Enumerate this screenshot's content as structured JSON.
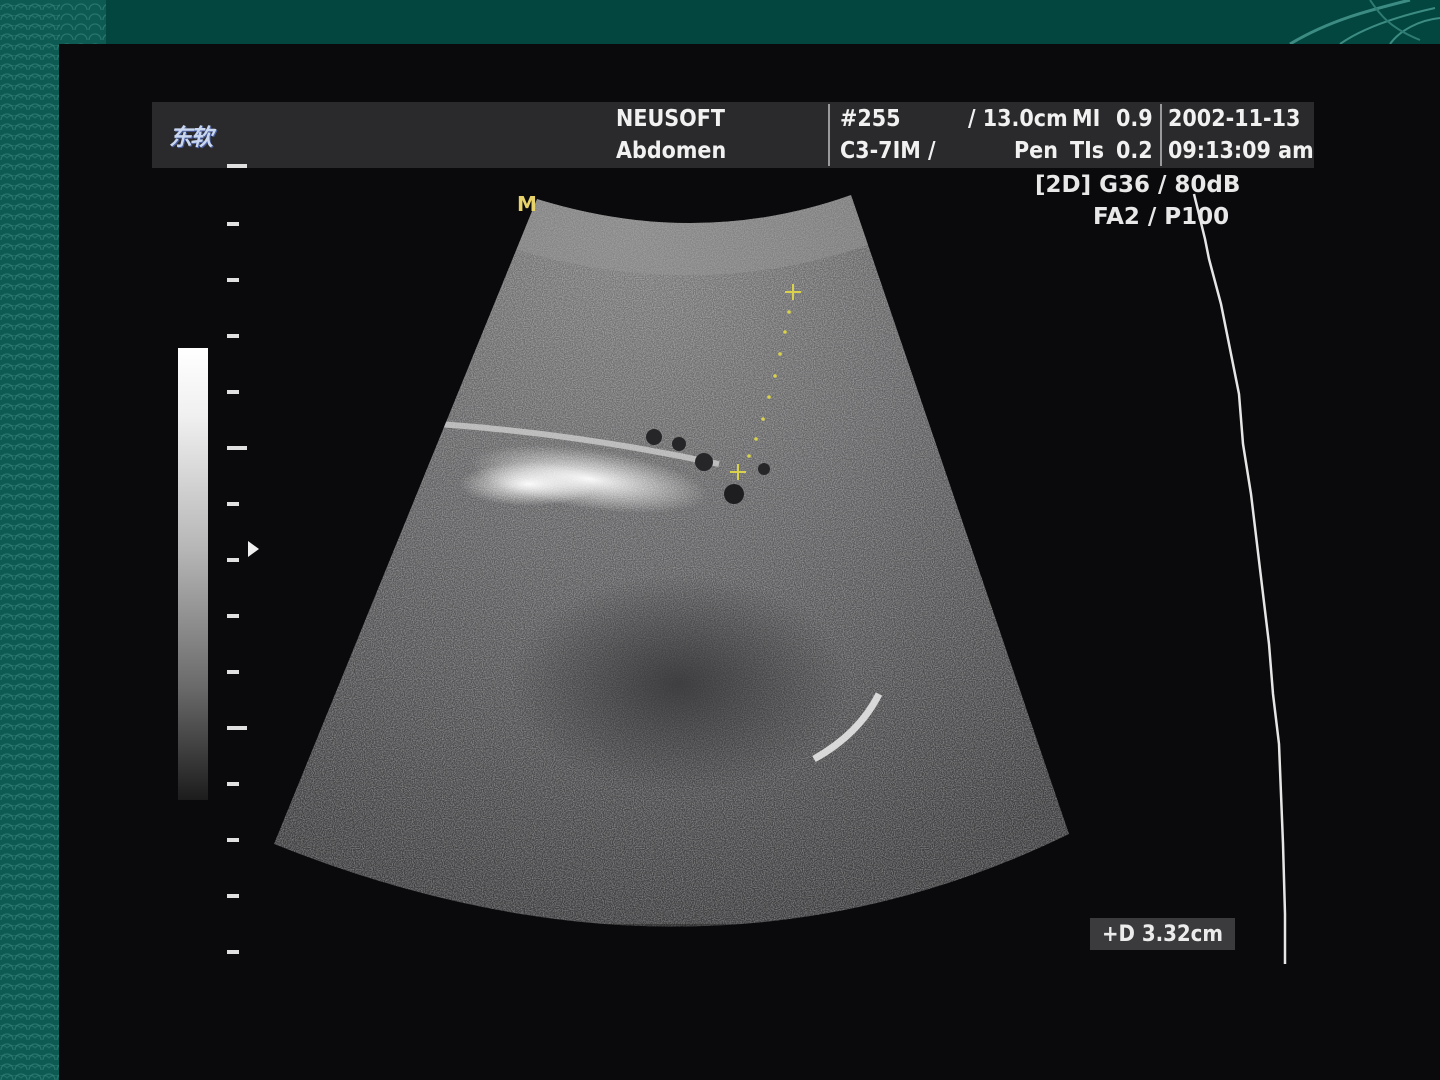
{
  "header": {
    "logo": "东软",
    "manufacturer": "NEUSOFT",
    "preset": "Abdomen",
    "image_number": "#255",
    "probe": "C3-7IM /",
    "depth": "/ 13.0cm",
    "mi_label": "MI",
    "mi_value": "0.9",
    "pen_label": "Pen",
    "tis_label": "TIs",
    "tis_value": "0.2",
    "date": "2002-11-13",
    "time": "09:13:09 am"
  },
  "imaging_params": {
    "line1": "[2D] G36 / 80dB",
    "line2": "FA2 / P100"
  },
  "markers": {
    "m_marker": "M"
  },
  "measurement": {
    "label": "+D 3.32cm"
  },
  "colors": {
    "theme_green": "#02463f",
    "caliper": "#d9d24a",
    "screen_bg": "#0a0a0c"
  },
  "icons": [
    "neusoft-logo-icon",
    "focus-arrow-icon",
    "caliper-cross-icon"
  ]
}
